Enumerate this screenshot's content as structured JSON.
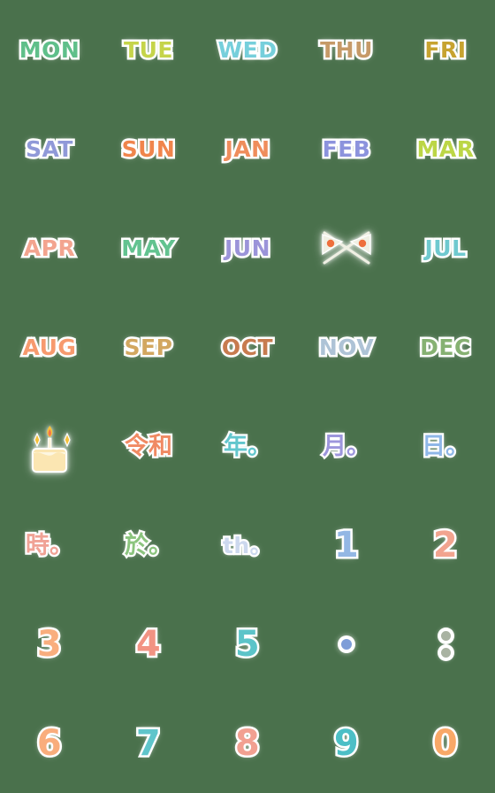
{
  "sheet": {
    "background_color": "#4a714c",
    "columns": 5,
    "rows": 8,
    "title": "Calendar emoji sticker sheet"
  },
  "items": [
    {
      "id": "mon",
      "type": "text",
      "label": "MON",
      "color": "#5fbf8a",
      "name": "sticker-mon"
    },
    {
      "id": "tue",
      "type": "text",
      "label": "TUE",
      "color": "#c5d44a",
      "name": "sticker-tue"
    },
    {
      "id": "wed",
      "type": "text",
      "label": "WED",
      "color": "#76cfdb",
      "name": "sticker-wed"
    },
    {
      "id": "thu",
      "type": "text",
      "label": "THU",
      "color": "#c69a68",
      "name": "sticker-thu"
    },
    {
      "id": "fri",
      "type": "text",
      "label": "FRI",
      "color": "#c7a330",
      "name": "sticker-fri"
    },
    {
      "id": "sat",
      "type": "text",
      "label": "SAT",
      "color": "#9099d8",
      "name": "sticker-sat"
    },
    {
      "id": "sun",
      "type": "text",
      "label": "SUN",
      "color": "#f0854c",
      "name": "sticker-sun"
    },
    {
      "id": "jan",
      "type": "text",
      "label": "JAN",
      "color": "#ef8d5c",
      "name": "sticker-jan"
    },
    {
      "id": "feb",
      "type": "text",
      "label": "FEB",
      "color": "#8c93dd",
      "name": "sticker-feb"
    },
    {
      "id": "mar",
      "type": "text",
      "label": "MAR",
      "color": "#bcd646",
      "name": "sticker-mar"
    },
    {
      "id": "apr",
      "type": "text",
      "label": "APR",
      "color": "#f3a48f",
      "name": "sticker-apr"
    },
    {
      "id": "may",
      "type": "text",
      "label": "MAY",
      "color": "#63c390",
      "name": "sticker-may"
    },
    {
      "id": "jun",
      "type": "text",
      "label": "JUN",
      "color": "#9b94d9",
      "name": "sticker-jun"
    },
    {
      "id": "flags",
      "type": "flags",
      "label": "crossed flags",
      "color": "#f0f0e4",
      "accent": "#ee6f3c",
      "name": "sticker-crossed-flags"
    },
    {
      "id": "jul",
      "type": "text",
      "label": "JUL",
      "color": "#6fc9cf",
      "name": "sticker-jul"
    },
    {
      "id": "aug",
      "type": "text",
      "label": "AUG",
      "color": "#f79a6e",
      "name": "sticker-aug"
    },
    {
      "id": "sep",
      "type": "text",
      "label": "SEP",
      "color": "#d2a760",
      "name": "sticker-sep"
    },
    {
      "id": "oct",
      "type": "text",
      "label": "OCT",
      "color": "#c77b4f",
      "name": "sticker-oct"
    },
    {
      "id": "nov",
      "type": "text",
      "label": "NOV",
      "color": "#aec3d6",
      "name": "sticker-nov"
    },
    {
      "id": "dec",
      "type": "text",
      "label": "DEC",
      "color": "#86b172",
      "name": "sticker-dec"
    },
    {
      "id": "cake",
      "type": "cake",
      "label": "birthday cake",
      "color": "#fbe6b2",
      "accent": "#f4c13c",
      "name": "sticker-birthday-cake"
    },
    {
      "id": "reiwa",
      "type": "jp",
      "label": "令和",
      "color": "#f08a63",
      "name": "sticker-reiwa"
    },
    {
      "id": "nen",
      "type": "jp",
      "label": "年。",
      "color": "#62c6cd",
      "name": "sticker-year"
    },
    {
      "id": "gatsu",
      "type": "jp",
      "label": "月。",
      "color": "#9d96dc",
      "name": "sticker-month"
    },
    {
      "id": "nichi",
      "type": "jp",
      "label": "日。",
      "color": "#8fb7e8",
      "name": "sticker-day"
    },
    {
      "id": "ji",
      "type": "jp",
      "label": "時。",
      "color": "#f0a295",
      "name": "sticker-hour"
    },
    {
      "id": "oite",
      "type": "jp",
      "label": "於。",
      "color": "#8bc47e",
      "name": "sticker-at"
    },
    {
      "id": "th",
      "type": "small",
      "label": "th。",
      "color": "#ccd8ee",
      "name": "sticker-th"
    },
    {
      "id": "n1",
      "type": "num",
      "label": "1",
      "color": "#93b7e4",
      "name": "sticker-digit-1"
    },
    {
      "id": "n2",
      "type": "num",
      "label": "2",
      "color": "#f2a48f",
      "name": "sticker-digit-2"
    },
    {
      "id": "n3",
      "type": "num",
      "label": "3",
      "color": "#f9ae7e",
      "name": "sticker-digit-3"
    },
    {
      "id": "n4",
      "type": "num",
      "label": "4",
      "color": "#f29383",
      "name": "sticker-digit-4"
    },
    {
      "id": "n5",
      "type": "num",
      "label": "5",
      "color": "#5cc4c9",
      "name": "sticker-digit-5"
    },
    {
      "id": "dot",
      "type": "period",
      "label": ".",
      "color": "#7e9dd8",
      "name": "sticker-period"
    },
    {
      "id": "colon",
      "type": "colon",
      "label": ":",
      "color": "#a9b3a2",
      "name": "sticker-colon"
    },
    {
      "id": "n6",
      "type": "num",
      "label": "6",
      "color": "#f9ad7c",
      "name": "sticker-digit-6"
    },
    {
      "id": "n7",
      "type": "num",
      "label": "7",
      "color": "#5fc5cb",
      "name": "sticker-digit-7"
    },
    {
      "id": "n8",
      "type": "num",
      "label": "8",
      "color": "#f2a091",
      "name": "sticker-digit-8"
    },
    {
      "id": "n9",
      "type": "num",
      "label": "9",
      "color": "#4cbfc6",
      "name": "sticker-digit-9"
    },
    {
      "id": "n0",
      "type": "num",
      "label": "0",
      "color": "#f9a867",
      "name": "sticker-digit-0"
    }
  ]
}
